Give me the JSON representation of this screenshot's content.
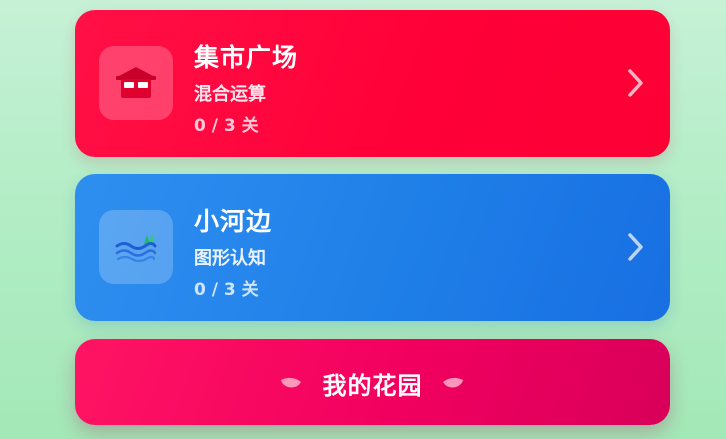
{
  "levels": [
    {
      "title": "集市广场",
      "subtitle": "混合运算",
      "progress": "0 / 3 关",
      "icon": "market-stall-icon",
      "color": "#ff0038"
    },
    {
      "title": "小河边",
      "subtitle": "图形认知",
      "progress": "0 / 3 关",
      "icon": "river-waves-icon",
      "color": "#1f7fe8"
    }
  ],
  "garden_button": {
    "label": "我的花园",
    "icon": "petal-icon",
    "color": "#f2005f"
  }
}
